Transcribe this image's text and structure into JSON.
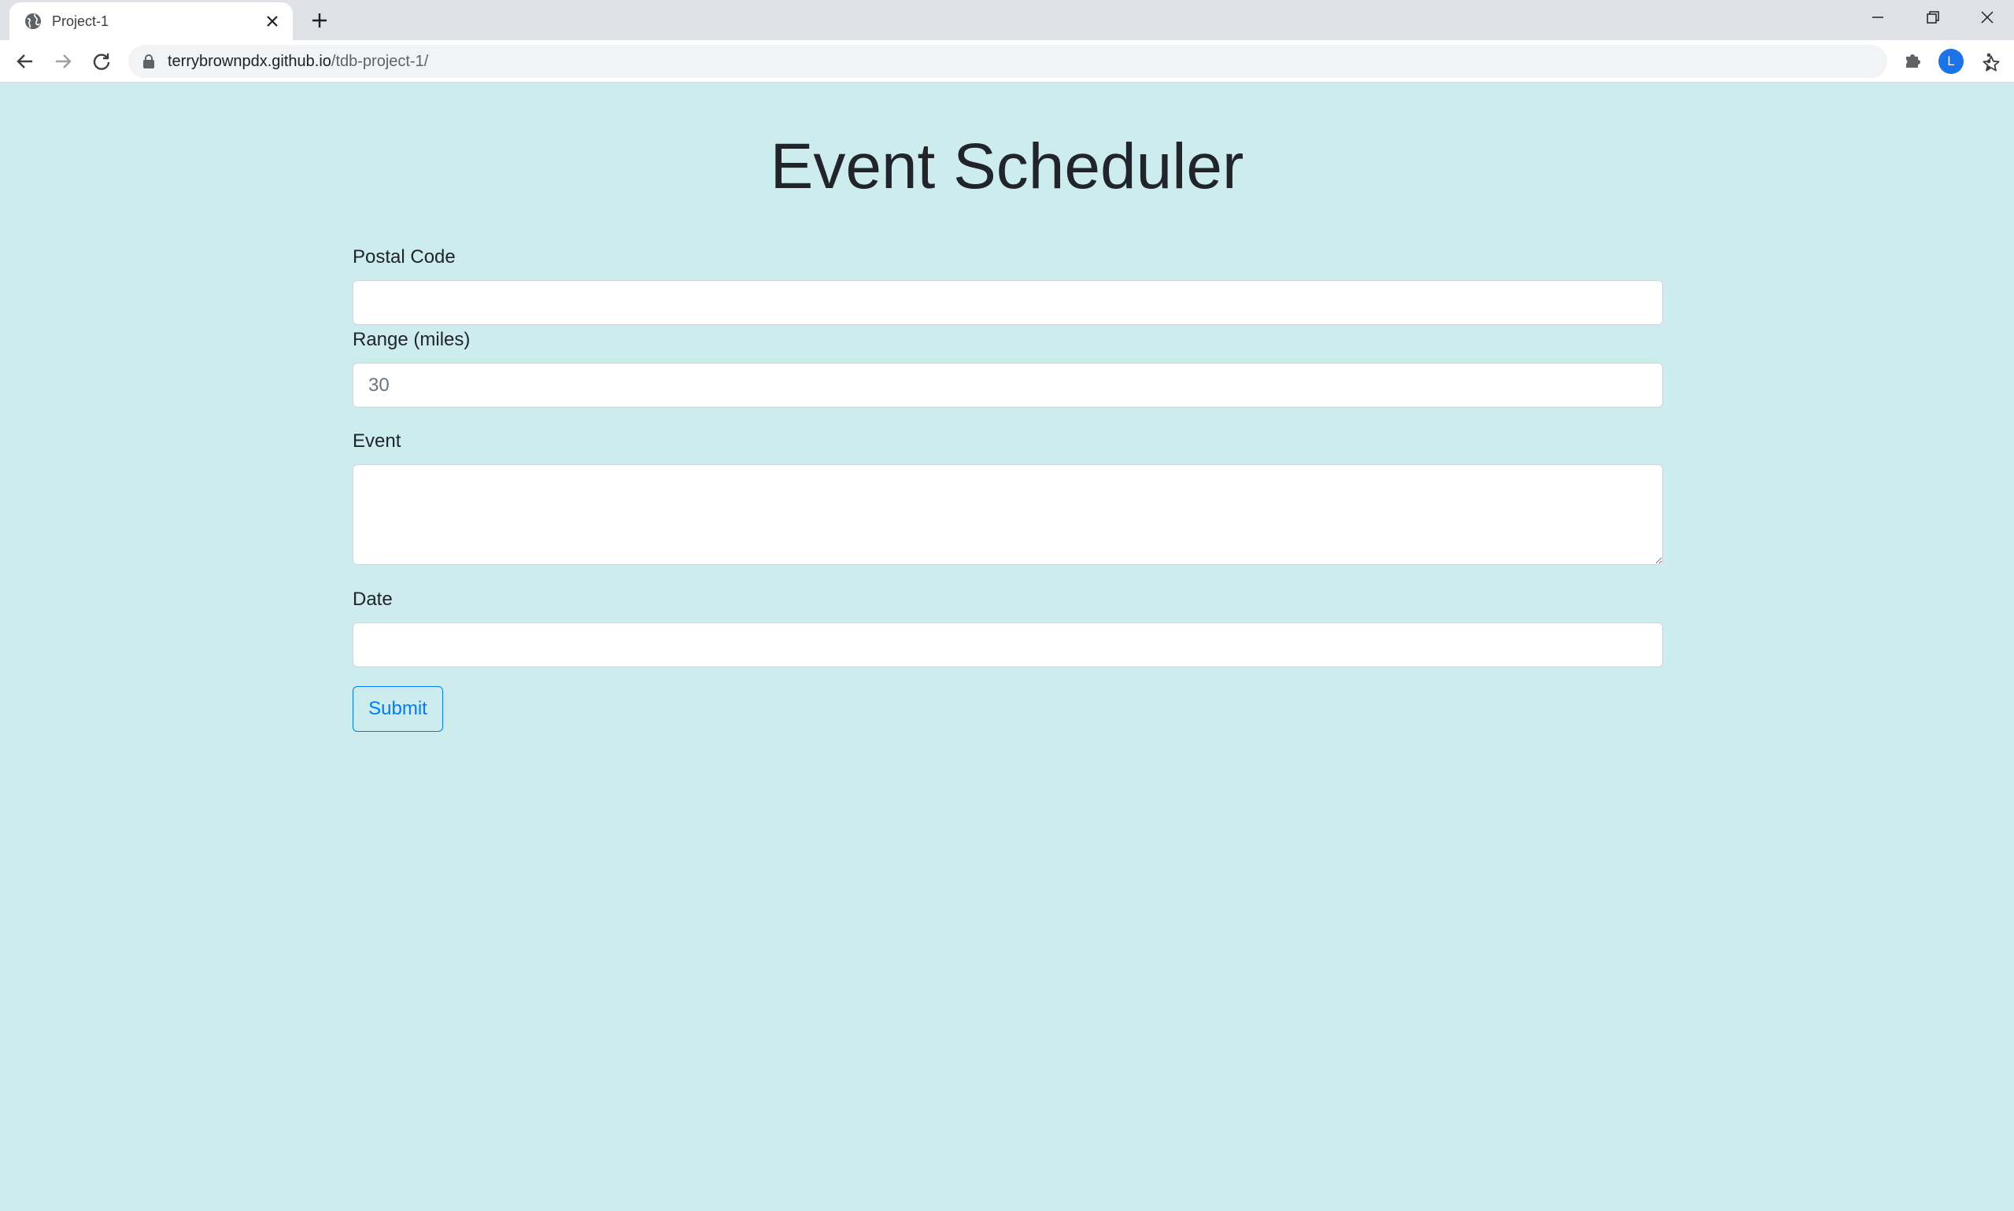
{
  "browser": {
    "tab_title": "Project-1",
    "url_host": "terrybrownpdx.github.io",
    "url_path": "/tdb-project-1/",
    "profile_initial": "L",
    "profile_color": "#1a73e8"
  },
  "page": {
    "title": "Event Scheduler",
    "background": "#cdecee",
    "accent": "#007bff"
  },
  "form": {
    "postal_code": {
      "label": "Postal Code",
      "value": "",
      "placeholder": ""
    },
    "range": {
      "label": "Range (miles)",
      "value": "",
      "placeholder": "30"
    },
    "event": {
      "label": "Event",
      "value": "",
      "placeholder": ""
    },
    "date": {
      "label": "Date",
      "value": "",
      "placeholder": ""
    },
    "submit_label": "Submit"
  },
  "icons": {
    "tab_favicon": "globe-icon",
    "tab_close": "close-icon",
    "new_tab": "plus-icon",
    "back": "arrow-left-icon",
    "forward": "arrow-right-icon",
    "reload": "reload-icon",
    "secure": "lock-icon",
    "bookmark": "star-icon",
    "extensions": "puzzle-icon",
    "menu": "kebab-menu-icon"
  }
}
